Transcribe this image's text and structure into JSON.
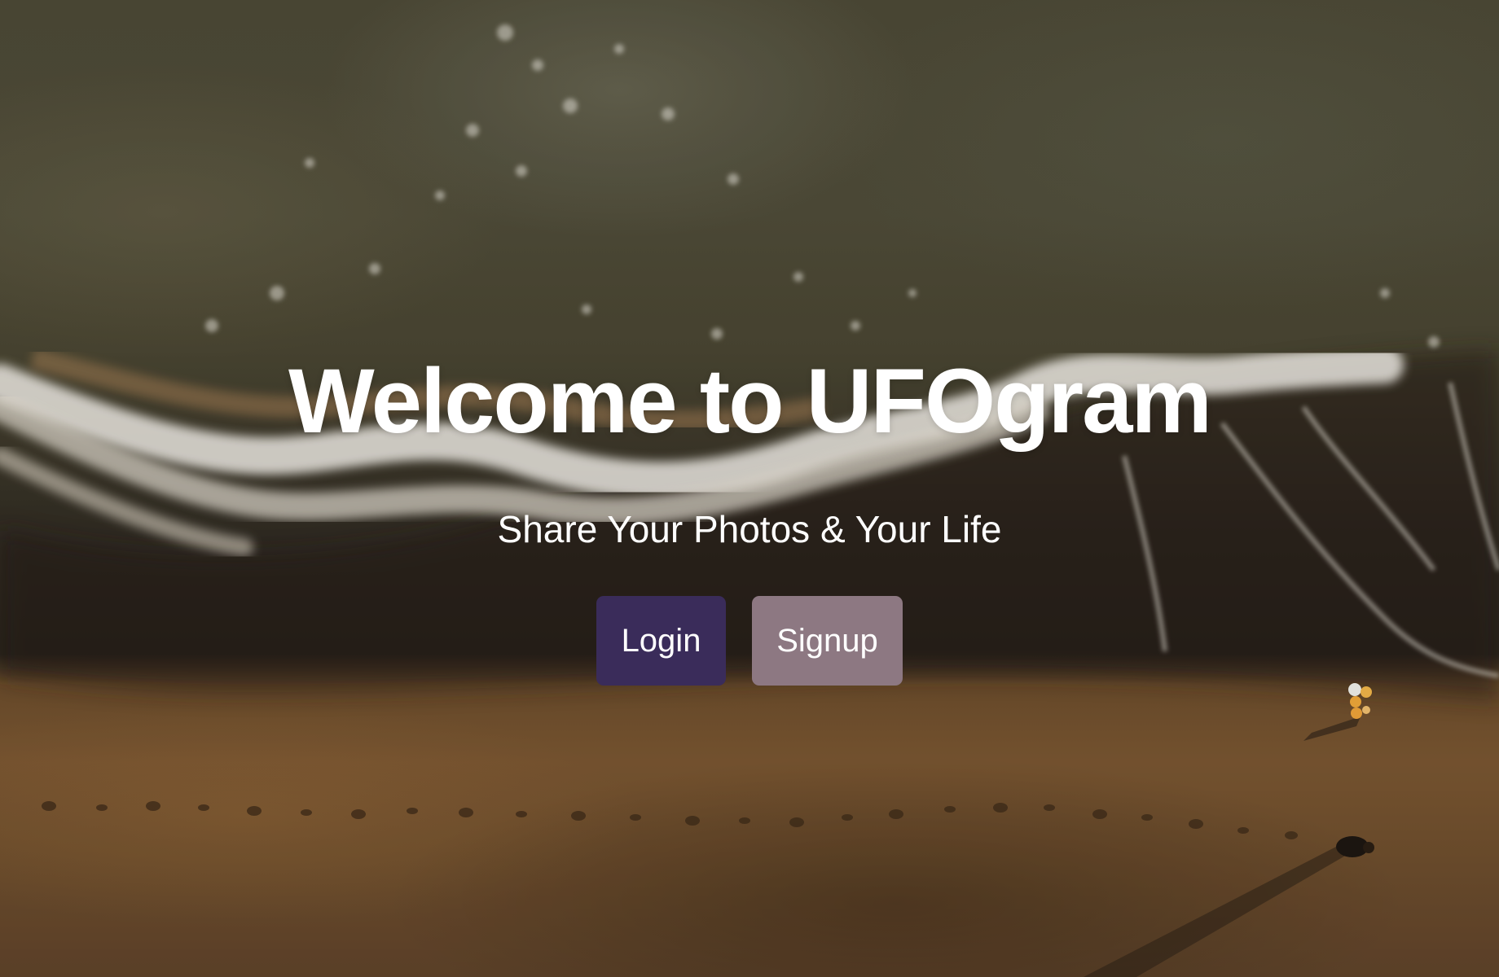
{
  "hero": {
    "title": "Welcome to UFOgram",
    "subtitle": "Share Your Photos & Your Life"
  },
  "buttons": {
    "login_label": "Login",
    "signup_label": "Signup"
  },
  "colors": {
    "login_bg": "#3a2c5a",
    "signup_bg": "#8d7882",
    "text": "#ffffff"
  },
  "background": {
    "icon": "aerial-beach-waves-image"
  }
}
